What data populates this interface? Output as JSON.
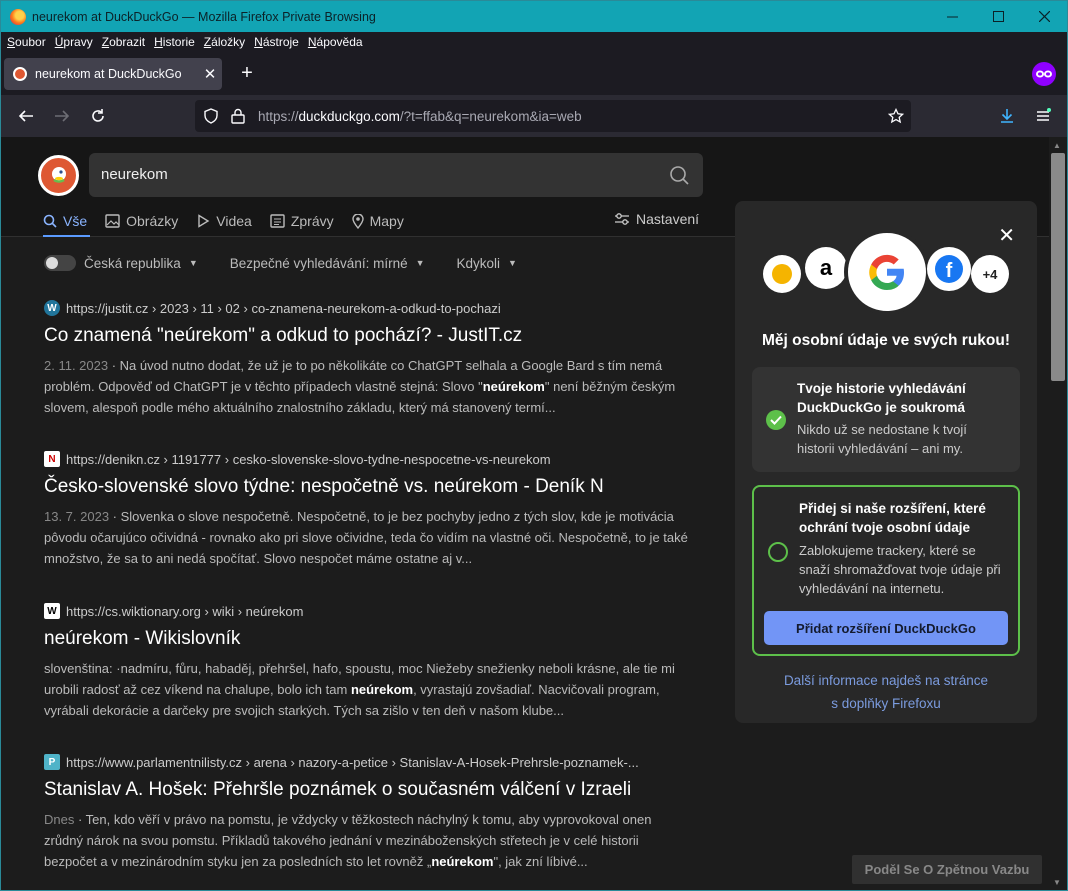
{
  "window": {
    "title": "neurekom at DuckDuckGo — Mozilla Firefox Private Browsing",
    "controls": {
      "minimize": "—",
      "maximize": "☐",
      "close": "✕"
    }
  },
  "menu": [
    "Soubor",
    "Úpravy",
    "Zobrazit",
    "Historie",
    "Záložky",
    "Nástroje",
    "Nápověda"
  ],
  "tab": {
    "title": "neurekom at DuckDuckGo",
    "close": "✕",
    "new": "+"
  },
  "urlbar": {
    "scheme": "https://",
    "host": "duckduckgo.com",
    "path": "/?t=ffab&q=neurekom&ia=web"
  },
  "search": {
    "value": "neurekom"
  },
  "vertical_tabs": [
    "Vše",
    "Obrázky",
    "Videa",
    "Zprávy",
    "Mapy"
  ],
  "settings_label": "Nastavení",
  "filters": {
    "region": "Česká republika",
    "safe_search": "Bezpečné vyhledávání: mírné",
    "time": "Kdykoli"
  },
  "results": [
    {
      "favicon": "W",
      "url": "https://justit.cz › 2023 › 11 › 02 › co-znamena-neurekom-a-odkud-to-pochazi",
      "title": "Co znamená \"neúrekom\" a odkud to pochází? - JustIT.cz",
      "date": "2. 11. 2023",
      "snippet_a": " · Na úvod nutno dodat, že už je to po několikáte co ChatGPT selhala a Google Bard s tím nemá problém. Odpověď od ChatGPT je v těchto případech vlastně stejná: Slovo \"",
      "snippet_bold": "neúrekom",
      "snippet_b": "\" není běžným českým slovem, alespoň podle mého aktuálního znalostního základu, který má stanovený termí..."
    },
    {
      "favicon": "N",
      "url": "https://denikn.cz › 1191777 › cesko-slovenske-slovo-tydne-nespocetne-vs-neurekom",
      "title": "Česko-slovenské slovo týdne: nespočetně vs. neúrekom - Deník N",
      "date": "13. 7. 2023",
      "snippet_a": " · Slovenka o slove nespočetně. Nespočetně, to je bez pochyby jedno z tých slov, kde je motivácia pôvodu očarujúco očividná - rovnako ako pri slove očividne, teda čo vidím na vlastné oči. Nespočetně, to je také množstvo, že sa to ani nedá spočítať. Slovo nespočet máme ostatne aj v...",
      "snippet_bold": "",
      "snippet_b": ""
    },
    {
      "favicon": "W",
      "url": "https://cs.wiktionary.org › wiki › neúrekom",
      "title": "neúrekom - Wikislovník",
      "date": "",
      "snippet_a": "slovenština: ·nadmíru, fůru, habaděj, přehršel, hafo, spoustu, moc Niežeby snežienky neboli krásne, ale tie mi urobili radosť až cez víkend na chalupe, bolo ich tam ",
      "snippet_bold": "neúrekom",
      "snippet_b": ", vyrastajú zovšadiaľ. Nacvičovali program, vyrábali dekorácie a darčeky pre svojich starkých. Tých sa zišlo v ten deň v našom klube..."
    },
    {
      "favicon": "P",
      "url": "https://www.parlamentnilisty.cz › arena › nazory-a-petice › Stanislav-A-Hosek-Prehrsle-poznamek-...",
      "title": "Stanislav A. Hošek: Přehršle poznámek o současném válčení v Izraeli",
      "date": "Dnes",
      "snippet_a": " · Ten, kdo věří v právo na pomstu, je vždycky v těžkostech náchylný k tomu, aby vyprovokoval onen zrůdný nárok na svou pomstu. Příkladů takového jednání v mezináboženských střetech je v celé historii bezpočet a v mezinárodním styku jen za posledních sto let rovněž „",
      "snippet_bold": "neúrekom",
      "snippet_b": "\", jak zní líbivé..."
    }
  ],
  "panel": {
    "close": "✕",
    "logos": {
      "a": "a",
      "fb": "f",
      "more": "+4"
    },
    "heading": "Měj osobní údaje ve svých rukou!",
    "card1_title": "Tvoje historie vyhledávání DuckDuckGo je soukromá",
    "card1_body": "Nikdo už se nedostane k tvojí historii vyhledávání – ani my.",
    "card2_title": "Přidej si naše rozšíření, které ochrání tvoje osobní údaje",
    "card2_body": "Zablokujeme trackery, které se snaží shromažďovat tvoje údaje při vyhledávání na internetu.",
    "cta": "Přidat rozšíření DuckDuckGo",
    "link_line1": "Další informace najdeš na stránce",
    "link_line2": "s doplňky Firefoxu"
  },
  "feedback": "Poděl Se O Zpětnou Vazbu",
  "colors": {
    "accent": "#12a4b4",
    "link": "#8ab4ff",
    "cta": "#7295f6",
    "green": "#5dc04a"
  }
}
